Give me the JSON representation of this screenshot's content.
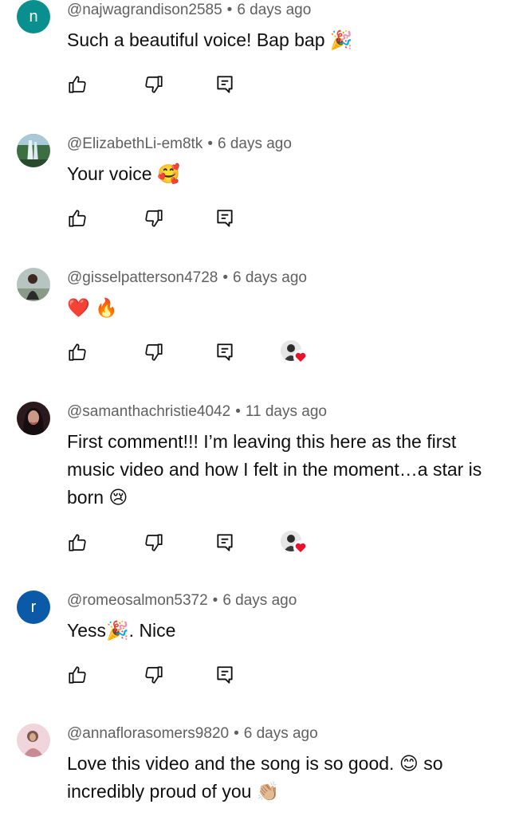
{
  "colors": {
    "text": "#0f0f0f",
    "meta": "#606060",
    "icon": "#0f0f0f",
    "heart": "#e8122b"
  },
  "icons": {
    "like": "thumb-up-icon",
    "dislike": "thumb-down-icon",
    "reply": "reply-comment-icon",
    "creator_heart": "creator-heart-icon"
  },
  "comments": [
    {
      "handle": "@najwagrandison2585",
      "separator": "•",
      "time": "6 days ago",
      "text": "Such a beautiful voice! Bap bap 🎉",
      "avatar": {
        "type": "letter",
        "letter": "n",
        "color": "#0a8f8f"
      },
      "hearted": false
    },
    {
      "handle": "@ElizabethLi-em8tk",
      "separator": "•",
      "time": "6 days ago",
      "text": "Your voice 🥰",
      "avatar": {
        "type": "photo",
        "scene": "waterfall"
      },
      "hearted": false
    },
    {
      "handle": "@gisselpatterson4728",
      "separator": "•",
      "time": "6 days ago",
      "text": "❤️ 🔥",
      "avatar": {
        "type": "photo",
        "scene": "person-outdoor"
      },
      "hearted": true
    },
    {
      "handle": "@samanthachristie4042",
      "separator": "•",
      "time": "11 days ago",
      "text": "First comment!!! I’m leaving this here as the first music video and how I felt in the moment…a star is born 😢",
      "avatar": {
        "type": "photo",
        "scene": "portrait-dark-hair"
      },
      "hearted": true
    },
    {
      "handle": "@romeosalmon5372",
      "separator": "•",
      "time": "6 days ago",
      "text": "Yess🎉. Nice",
      "avatar": {
        "type": "letter",
        "letter": "r",
        "color": "#0b5aa8"
      },
      "hearted": false
    },
    {
      "handle": "@annaflorasomers9820",
      "separator": "•",
      "time": "6 days ago",
      "text": "Love this video and the song is so good. 😊 so incredibly proud of you 👏🏼",
      "avatar": {
        "type": "photo",
        "scene": "portrait-pink"
      },
      "hearted": false
    }
  ]
}
